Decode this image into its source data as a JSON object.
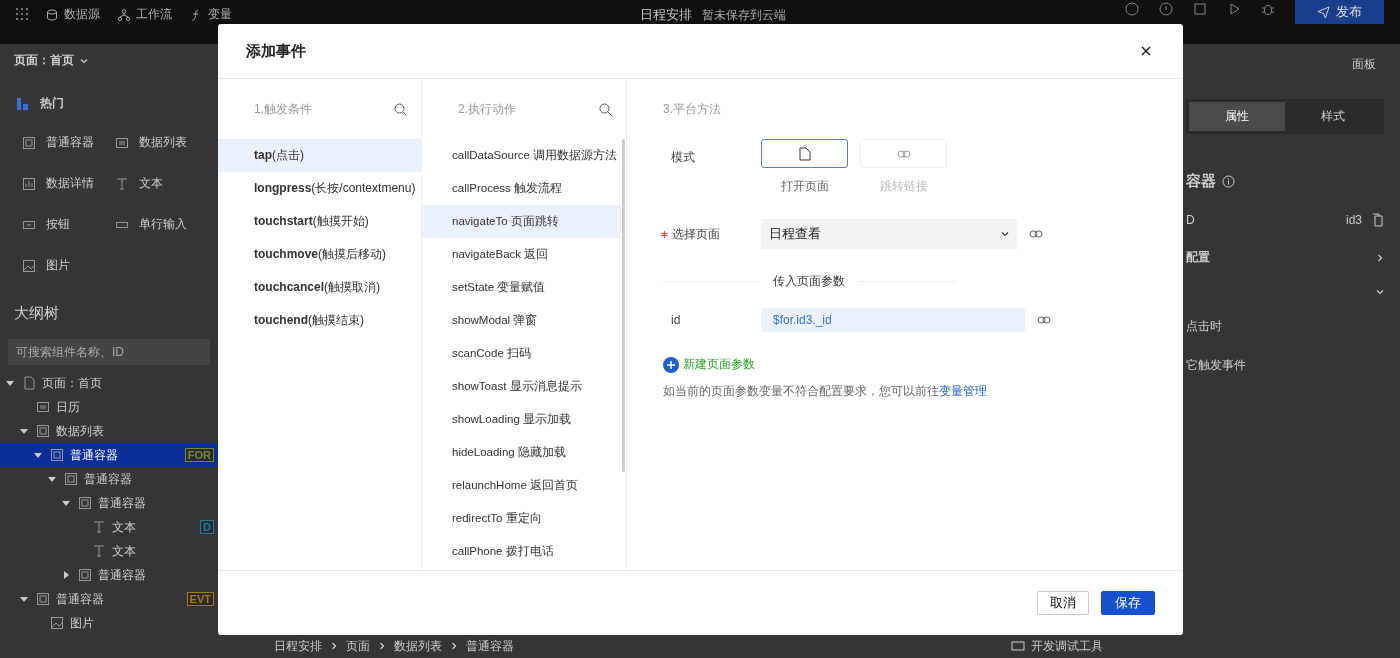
{
  "topbar": {
    "nav": [
      {
        "label": "数据源",
        "kind": "db"
      },
      {
        "label": "工作流",
        "kind": "flow"
      },
      {
        "label": "变量",
        "kind": "fx"
      }
    ],
    "title": "日程安排",
    "status": "暂未保存到云端",
    "publish": "发布"
  },
  "left": {
    "page_selector": "页面：首页",
    "hot_title": "热门",
    "components": [
      {
        "label": "普通容器",
        "kind": "box"
      },
      {
        "label": "数据列表",
        "kind": "list"
      },
      {
        "label": "数据详情",
        "kind": "chart"
      },
      {
        "label": "文本",
        "kind": "text"
      },
      {
        "label": "按钮",
        "kind": "button"
      },
      {
        "label": "单行输入",
        "kind": "input"
      },
      {
        "label": "图片",
        "kind": "image"
      }
    ],
    "outline_title": "大纲树",
    "search": {
      "placeholder": "可搜索组件名称、ID"
    },
    "tree": [
      {
        "label": "页面：首页",
        "kind": "page",
        "expanded": true,
        "selected": false,
        "children": [
          {
            "label": "日历",
            "kind": "list",
            "selected": false
          },
          {
            "label": "数据列表",
            "kind": "box",
            "expanded": true,
            "selected": false,
            "children": [
              {
                "label": "普通容器",
                "kind": "box",
                "expanded": true,
                "selected": true,
                "badge": "FOR",
                "color": "#7a8a2a",
                "children": [
                  {
                    "label": "普通容器",
                    "kind": "box",
                    "expanded": true,
                    "selected": false,
                    "children": [
                      {
                        "label": "普通容器",
                        "kind": "box",
                        "expanded": true,
                        "selected": false,
                        "children": [
                          {
                            "label": "文本",
                            "kind": "text",
                            "selected": false,
                            "badge": "D",
                            "color": "#1a7fa8"
                          },
                          {
                            "label": "文本",
                            "kind": "text",
                            "selected": false
                          }
                        ]
                      },
                      {
                        "label": "普通容器",
                        "kind": "box",
                        "expanded": false,
                        "selected": false
                      }
                    ]
                  }
                ]
              }
            ]
          },
          {
            "label": "普通容器",
            "kind": "box",
            "expanded": true,
            "selected": false,
            "badge": "EVT",
            "color": "#a8791a",
            "children": [
              {
                "label": "图片",
                "kind": "image",
                "selected": false
              }
            ]
          }
        ]
      }
    ]
  },
  "right": {
    "panel": "面板",
    "tabs": [
      {
        "label": "属性",
        "selected": true
      },
      {
        "label": "样式",
        "selected": false
      }
    ],
    "heading": "容器",
    "id_label": "D",
    "id_value": "id3",
    "config": "配置",
    "event_1": "点击时",
    "event_2": "它触发事件"
  },
  "breadcrumb": [
    "日程安排",
    "页面",
    "数据列表",
    "普通容器"
  ],
  "devtools": "开发调试工具",
  "modal": {
    "title": "添加事件",
    "triggers": {
      "heading": "1.触发条件",
      "items": [
        {
          "label": "**tap**(点击)",
          "selected": true
        },
        {
          "label": "**longpress**(长按/contextmenu)",
          "selected": false
        },
        {
          "label": "**touchstart**(触摸开始)",
          "selected": false
        },
        {
          "label": "**touchmove**(触摸后移动)",
          "selected": false
        },
        {
          "label": "**touchcancel**(触摸取消)",
          "selected": false
        },
        {
          "label": "**touchend**(触摸结束)",
          "selected": false
        }
      ]
    },
    "actions": {
      "heading": "2.执行动作",
      "items": [
        {
          "label": "callDataSource 调用数据源方法",
          "selected": false
        },
        {
          "label": "callProcess 触发流程",
          "selected": false
        },
        {
          "label": "navigateTo 页面跳转",
          "selected": true
        },
        {
          "label": "navigateBack 返回",
          "selected": false
        },
        {
          "label": "setState 变量赋值",
          "selected": false
        },
        {
          "label": "showModal 弹窗",
          "selected": false
        },
        {
          "label": "scanCode 扫码",
          "selected": false
        },
        {
          "label": "showToast 显示消息提示",
          "selected": false
        },
        {
          "label": "showLoading 显示加载",
          "selected": false
        },
        {
          "label": "hideLoading 隐藏加载",
          "selected": false
        },
        {
          "label": "relaunchHome 返回首页",
          "selected": false
        },
        {
          "label": "redirectTo 重定向",
          "selected": false
        },
        {
          "label": "callPhone 拨打电话",
          "selected": false
        }
      ]
    },
    "method": {
      "heading": "3.平台方法",
      "mode_label": "模式",
      "modes": [
        {
          "label": "打开页面",
          "kind": "page",
          "selected": true
        },
        {
          "label": "跳转链接",
          "kind": "link",
          "selected": false
        }
      ],
      "page_label": "选择页面",
      "required": true,
      "page_value": "日程查看",
      "params_title": "传入页面参数",
      "params": [
        {
          "name": "id",
          "value": "$for.id3._id"
        }
      ],
      "add_param": "新建页面参数",
      "hint": "如当前的页面参数变量不符合配置要求，您可以前往",
      "hint_link": "变量管理"
    },
    "cancel": "取消",
    "save": "保存"
  }
}
